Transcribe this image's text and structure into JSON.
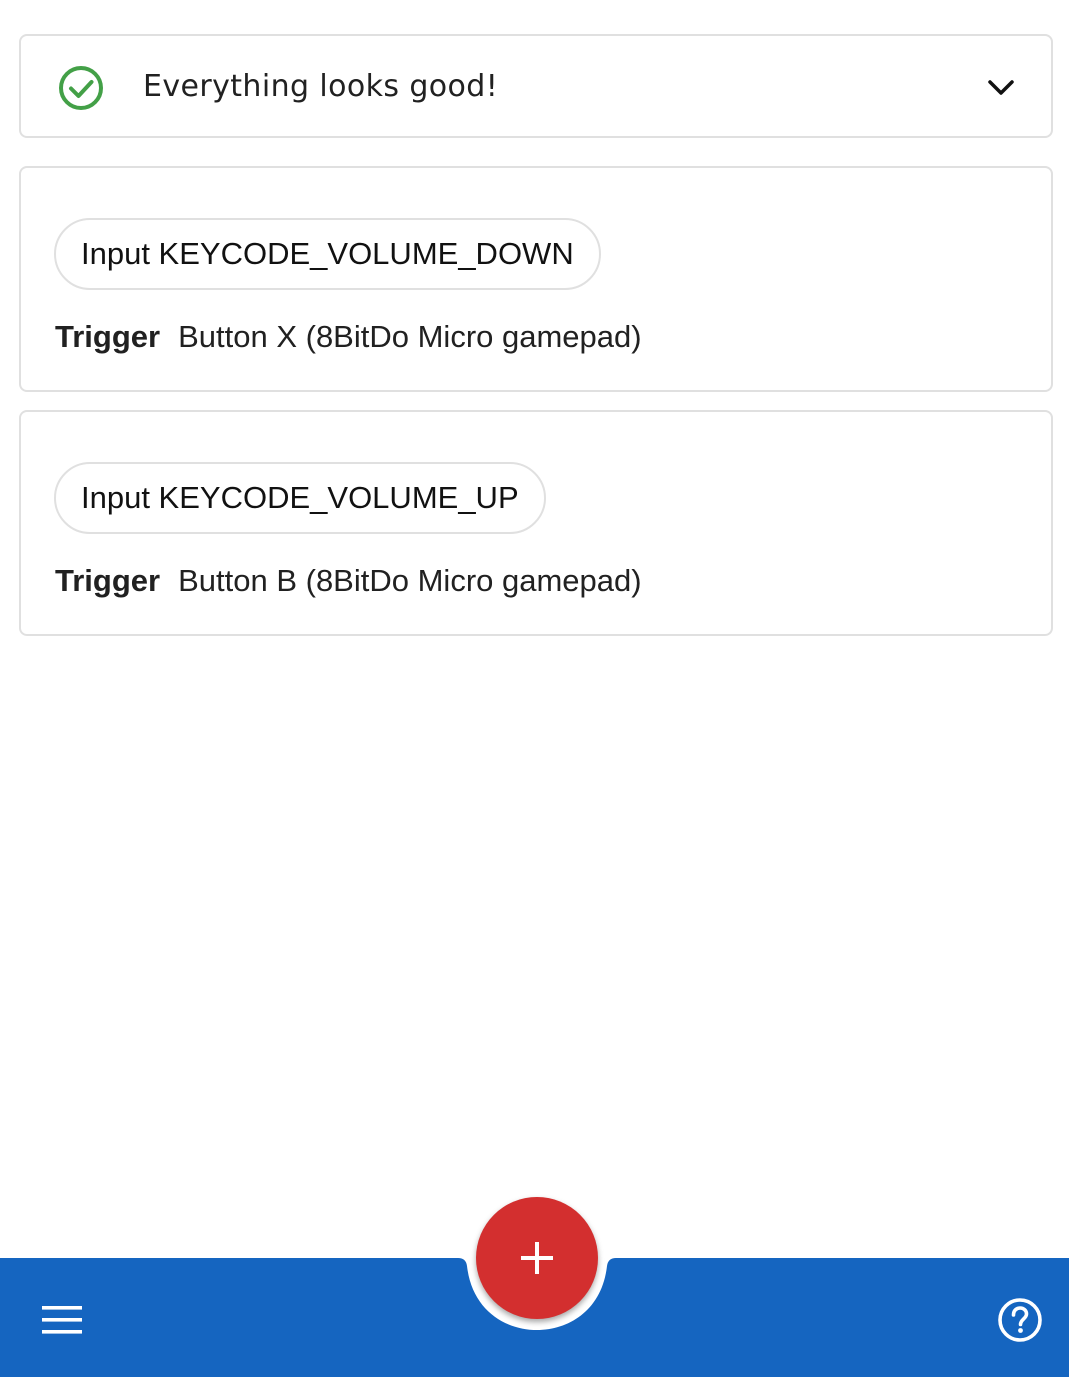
{
  "status": {
    "message": "Everything looks good!",
    "icon": "check-circle-icon",
    "icon_color": "#43a047",
    "expand_icon": "chevron-down-icon"
  },
  "mappings": [
    {
      "action_chip": "Input KEYCODE_VOLUME_DOWN",
      "trigger_label": "Trigger",
      "trigger_value": "Button X (8BitDo Micro gamepad)"
    },
    {
      "action_chip": "Input KEYCODE_VOLUME_UP",
      "trigger_label": "Trigger",
      "trigger_value": "Button B (8BitDo Micro gamepad)"
    }
  ],
  "bottom_bar": {
    "color": "#1565c0",
    "menu_icon": "menu-icon",
    "help_icon": "help-circle-icon",
    "fab_icon": "plus-icon",
    "fab_color": "#d32f2f"
  }
}
